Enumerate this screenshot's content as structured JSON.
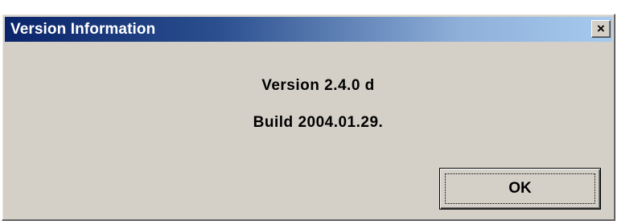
{
  "window": {
    "title": "Version Information",
    "close_glyph": "×",
    "close_icon": "close-icon"
  },
  "content": {
    "version_text": "Version 2.4.0 d",
    "build_text": "Build 2004.01.29."
  },
  "buttons": {
    "ok_label": "OK"
  },
  "colors": {
    "titlebar_start": "#0a246a",
    "titlebar_end": "#a6caf0",
    "dialog_face": "#d4d0c8"
  }
}
